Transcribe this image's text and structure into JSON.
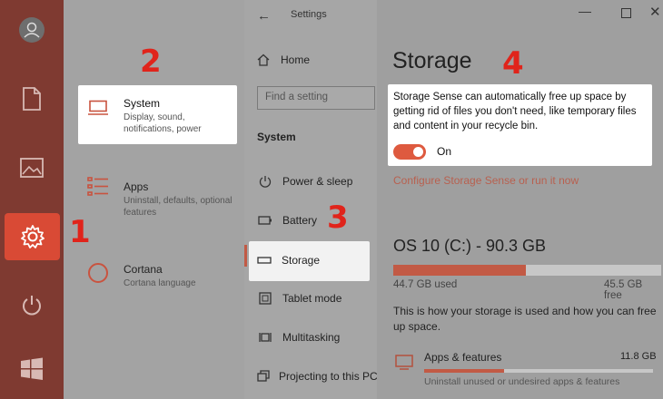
{
  "window": {
    "title": "Settings"
  },
  "home": {
    "categories": [
      {
        "title": "System",
        "desc": "Display, sound, notifications, power"
      },
      {
        "title": "Apps",
        "desc": "Uninstall, defaults, optional features"
      },
      {
        "title": "Cortana",
        "desc": "Cortana language"
      }
    ]
  },
  "nav": {
    "home": "Home",
    "search_placeholder": "Find a setting",
    "section": "System",
    "items": [
      "Power & sleep",
      "Battery",
      "Storage",
      "Tablet mode",
      "Multitasking",
      "Projecting to this PC"
    ]
  },
  "storage": {
    "title": "Storage",
    "sense_desc": "Storage Sense can automatically free up space by getting rid of files you don't need, like temporary files and content in your recycle bin.",
    "toggle_label": "On",
    "configure_link": "Configure Storage Sense or run it now",
    "drive_title": "OS 10 (C:) - 90.3 GB",
    "used": "44.7 GB used",
    "free": "45.5 GB free",
    "used_fraction": 0.495,
    "usage_text": "This is how your storage is used and how you can free up space.",
    "apps_label": "Apps & features",
    "apps_size": "11.8 GB",
    "apps_desc": "Uninstall unused or undesired apps & features",
    "apps_fraction": 0.35
  },
  "steps": [
    "1",
    "2",
    "3",
    "4"
  ]
}
